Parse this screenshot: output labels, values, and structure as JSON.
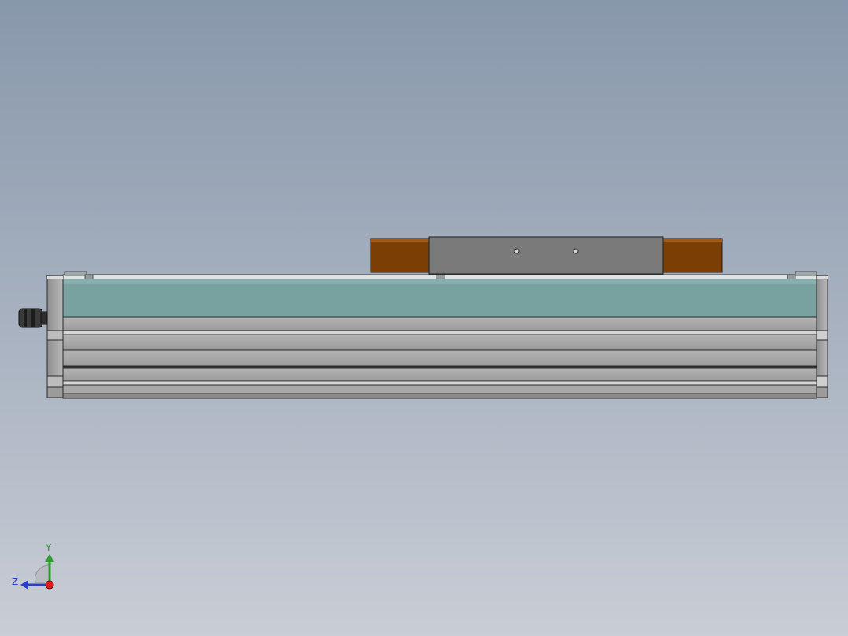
{
  "viewport": {
    "colors": {
      "background_top": "#8898ab",
      "background_bottom": "#c9cdd5",
      "body_cover": "#78a2a0",
      "profile_gray": "#a6a6a6",
      "carriage_gray": "#7a7a7a",
      "bumper_brown": "#7b3f06"
    }
  },
  "triad": {
    "y_label": "Y",
    "z_label": "Z",
    "colors": {
      "y": "#2aa02a",
      "z": "#2a3fc8",
      "x": "#d81e1e"
    }
  }
}
